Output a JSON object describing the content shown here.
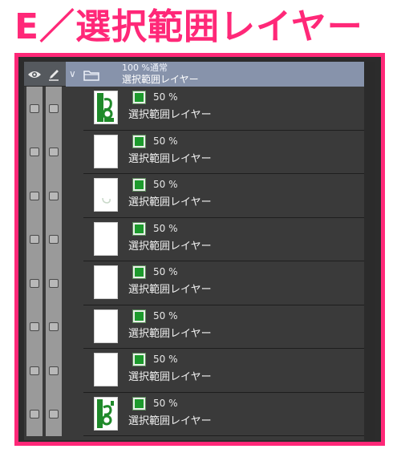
{
  "title": "E／選択範囲レイヤー",
  "colors": {
    "accent": "#ff2878",
    "folder_row": "#8793ab",
    "selection_green": "#1c9a2c"
  },
  "header": {
    "visibility_icon": "eye-icon",
    "edit_icon": "pencil-icon",
    "expand_icon": "chevron-down-icon",
    "folder_icon": "folder-icon",
    "folder_blend": "100 %通常",
    "folder_name": "選択範囲レイヤー"
  },
  "layers": [
    {
      "opacity": "50 %",
      "name": "選択範囲レイヤー",
      "thumb": "green-figure"
    },
    {
      "opacity": "50 %",
      "name": "選択範囲レイヤー",
      "thumb": "blank"
    },
    {
      "opacity": "50 %",
      "name": "選択範囲レイヤー",
      "thumb": "faint-swirl"
    },
    {
      "opacity": "50 %",
      "name": "選択範囲レイヤー",
      "thumb": "blank"
    },
    {
      "opacity": "50 %",
      "name": "選択範囲レイヤー",
      "thumb": "blank"
    },
    {
      "opacity": "50 %",
      "name": "選択範囲レイヤー",
      "thumb": "blank"
    },
    {
      "opacity": "50 %",
      "name": "選択範囲レイヤー",
      "thumb": "blank"
    },
    {
      "opacity": "50 %",
      "name": "選択範囲レイヤー",
      "thumb": "green-figure-2"
    }
  ]
}
